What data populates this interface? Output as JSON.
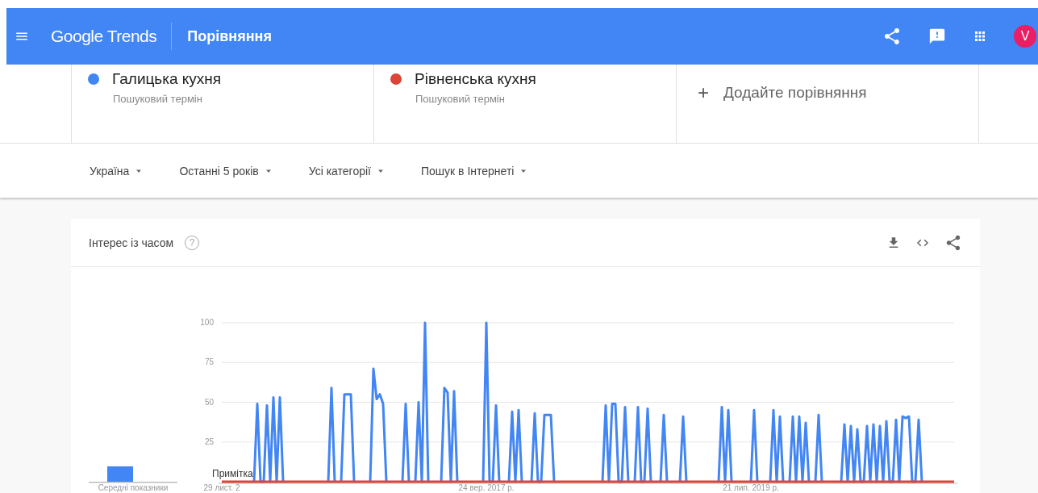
{
  "header": {
    "logo": "Google Trends",
    "title": "Порівняння",
    "avatar": "V"
  },
  "terms": [
    {
      "name": "Галицька кухня",
      "type": "Пошуковий термін",
      "color": "#4285f4"
    },
    {
      "name": "Рівненська кухня",
      "type": "Пошуковий термін",
      "color": "#db4437"
    }
  ],
  "add_comparison": {
    "icon": "+",
    "label": "Додайте порівняння"
  },
  "filters": [
    "Україна",
    "Останні 5 років",
    "Усі категорії",
    "Пошук в Інтернеті"
  ],
  "interest_card": {
    "title": "Інтерес із часом",
    "help_icon": "?",
    "average_label": "Середні показники",
    "date_labels": [
      "29 лист. 2",
      "24 вер. 2017 р.",
      "21 лип. 2019 р."
    ],
    "chart_data": {
      "type": "line",
      "ylim": [
        0,
        100
      ],
      "yticks": [
        25,
        50,
        75,
        100
      ],
      "grid": true,
      "annotations": [
        "Примітка"
      ],
      "series": [
        {
          "color": "#4285f4",
          "values": [
            null,
            null,
            null,
            null,
            null,
            null,
            null,
            null,
            null,
            null,
            0,
            49,
            0,
            0,
            48,
            0,
            53,
            0,
            53,
            0,
            null,
            null,
            null,
            null,
            null,
            null,
            null,
            null,
            null,
            null,
            null,
            null,
            null,
            0,
            59,
            0,
            null,
            0,
            55,
            55,
            55,
            0,
            null,
            null,
            null,
            null,
            0,
            71,
            52,
            55,
            49,
            0,
            null,
            null,
            null,
            null,
            0,
            49,
            0,
            null,
            0,
            50,
            0,
            100,
            0,
            null,
            null,
            null,
            0,
            59,
            56,
            0,
            57,
            0,
            null,
            null,
            null,
            null,
            null,
            null,
            null,
            0,
            100,
            0,
            0,
            48,
            0,
            null,
            null,
            0,
            44,
            0,
            45,
            0,
            null,
            null,
            0,
            43,
            0,
            0,
            42,
            42,
            42,
            0,
            null,
            null,
            null,
            null,
            null,
            null,
            null,
            null,
            null,
            null,
            null,
            null,
            null,
            null,
            0,
            48,
            0,
            49,
            49,
            0,
            0,
            47,
            0,
            null,
            0,
            47,
            0,
            0,
            46,
            0,
            null,
            null,
            0,
            42,
            0,
            null,
            null,
            null,
            0,
            41,
            0,
            null,
            null,
            null,
            null,
            null,
            null,
            null,
            null,
            null,
            0,
            47,
            0,
            45,
            0,
            null,
            null,
            null,
            null,
            null,
            0,
            45,
            0,
            null,
            null,
            null,
            0,
            45,
            0,
            41,
            0,
            null,
            0,
            41,
            0,
            41,
            0,
            37,
            0,
            null,
            0,
            42,
            0,
            null,
            null,
            null,
            null,
            null,
            0,
            36,
            0,
            35,
            0,
            33,
            0,
            0,
            35,
            0,
            36,
            0,
            35,
            0,
            38,
            0,
            0,
            39,
            0,
            41,
            40,
            41,
            0,
            0,
            39,
            0,
            null,
            null,
            null,
            null,
            null,
            null,
            null,
            null,
            null,
            null
          ]
        },
        {
          "color": "#db4437",
          "values": [
            0,
            0,
            0,
            0,
            0,
            0,
            0,
            0,
            0,
            0,
            0,
            0,
            0,
            0,
            0,
            0,
            0,
            0,
            0,
            0,
            0,
            0,
            0,
            0,
            0,
            0,
            0,
            0,
            0,
            0,
            0,
            0,
            0,
            0,
            0,
            0,
            0,
            0,
            0,
            0,
            0,
            0,
            0,
            0,
            0,
            0,
            0,
            0,
            0,
            0,
            0,
            0,
            0,
            0,
            0,
            0,
            0,
            0,
            0,
            0,
            0,
            0,
            0,
            0,
            0,
            0,
            0,
            0,
            0,
            0,
            0,
            0,
            0,
            0,
            0,
            0,
            0,
            0,
            0,
            0,
            0,
            0,
            0,
            0,
            0,
            0,
            0,
            0,
            0,
            0,
            0,
            0,
            0,
            0,
            0,
            0,
            0,
            0,
            0,
            0,
            0,
            0,
            0,
            0,
            0,
            0,
            0,
            0,
            0,
            0,
            0,
            0,
            0,
            0,
            0,
            0,
            0,
            0,
            0,
            0,
            0,
            0,
            0,
            0,
            0,
            0,
            0,
            0,
            0,
            0,
            0,
            0,
            0,
            0,
            0,
            0,
            0,
            0,
            0,
            0,
            0,
            0,
            0,
            0,
            0,
            0,
            0,
            0,
            0,
            0,
            0,
            0,
            0,
            0,
            0,
            0,
            0,
            0,
            0,
            0,
            0,
            0,
            0,
            0,
            0,
            0,
            0,
            0,
            0,
            0,
            0,
            0,
            0,
            0,
            0,
            0,
            0,
            0,
            0,
            0,
            0,
            0,
            0,
            0,
            0,
            0,
            0,
            0,
            0,
            0,
            0,
            0,
            0,
            0,
            0,
            0,
            0,
            0,
            0,
            0,
            0,
            0,
            0,
            0,
            0,
            0,
            0,
            0,
            0,
            0,
            0,
            0,
            0,
            0,
            0,
            0,
            0,
            0,
            0,
            0,
            0,
            0,
            0,
            0,
            0,
            0,
            0,
            0
          ]
        }
      ]
    }
  }
}
